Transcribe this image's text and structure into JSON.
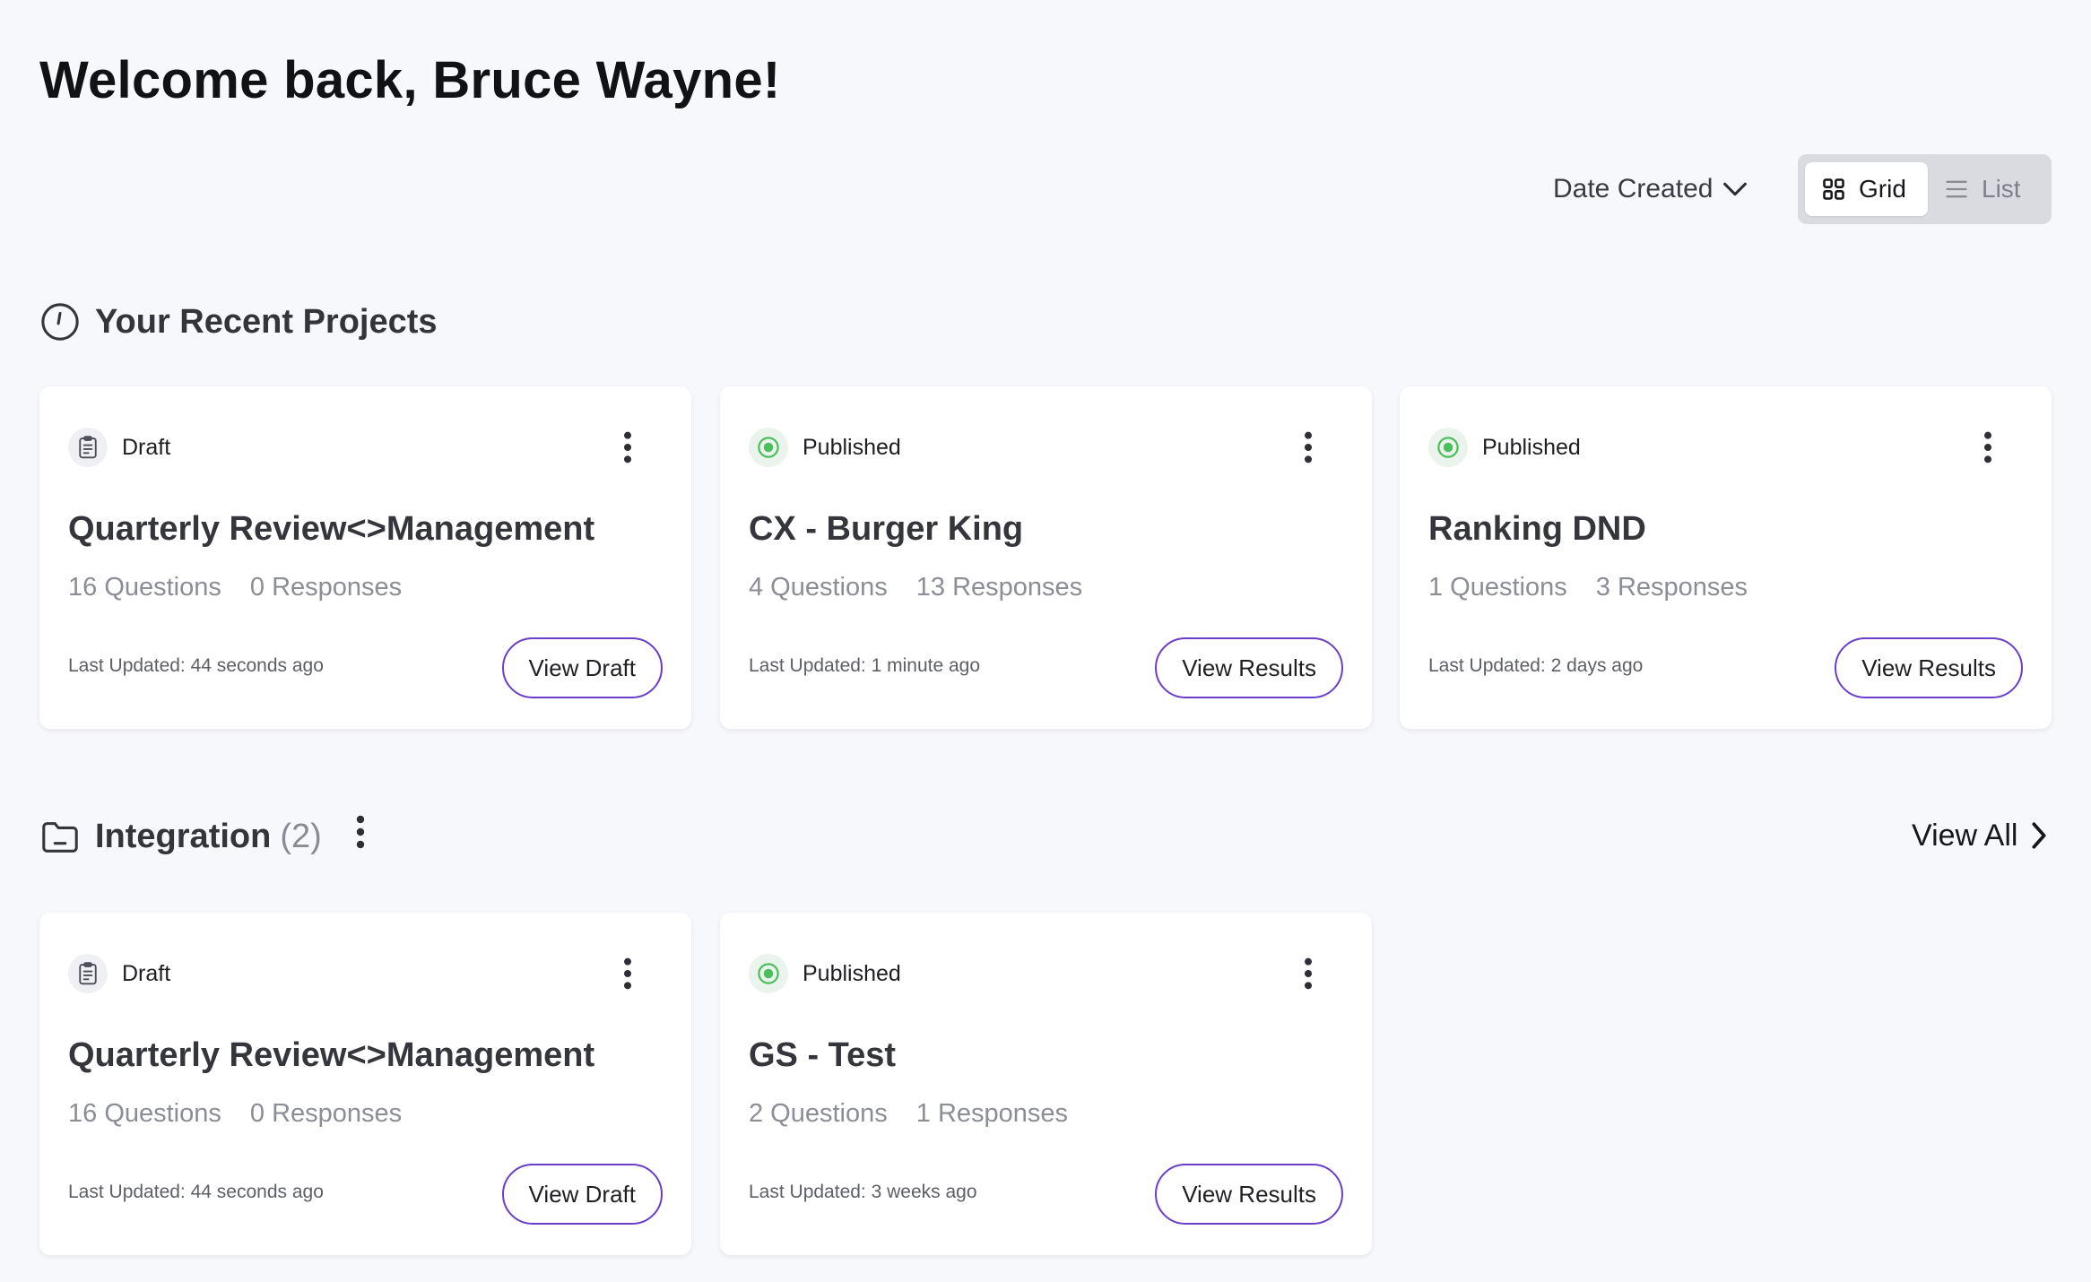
{
  "header": {
    "welcome": "Welcome back, Bruce Wayne!"
  },
  "toolbar": {
    "sort_label": "Date Created",
    "sort_icon": "chevron-down-icon",
    "view_grid": "Grid",
    "view_list": "List",
    "active_view": "Grid"
  },
  "recent": {
    "title": "Your Recent Projects",
    "icon": "clock-icon",
    "cards": [
      {
        "status": "Draft",
        "title": "Quarterly Review<>Management",
        "questions": "16 Questions",
        "responses": "0 Responses",
        "updated": "Last Updated: 44 seconds ago",
        "action": "View Draft"
      },
      {
        "status": "Published",
        "title": "CX - Burger King",
        "questions": "4 Questions",
        "responses": "13 Responses",
        "updated": "Last Updated: 1 minute ago",
        "action": "View Results"
      },
      {
        "status": "Published",
        "title": "Ranking DND",
        "questions": "1 Questions",
        "responses": "3 Responses",
        "updated": "Last Updated: 2 days ago",
        "action": "View Results"
      }
    ]
  },
  "folder": {
    "title": "Integration",
    "count": "(2)",
    "icon": "folder-icon",
    "view_all": "View All",
    "cards": [
      {
        "status": "Draft",
        "title": "Quarterly Review<>Management",
        "questions": "16 Questions",
        "responses": "0 Responses",
        "updated": "Last Updated: 44 seconds ago",
        "action": "View Draft"
      },
      {
        "status": "Published",
        "title": "GS - Test",
        "questions": "2 Questions",
        "responses": "1 Responses",
        "updated": "Last Updated: 3 weeks ago",
        "action": "View Results"
      }
    ]
  },
  "colors": {
    "accent": "#6a3ec9",
    "published_green": "#4cbf5d",
    "background": "#f7f8fc"
  }
}
